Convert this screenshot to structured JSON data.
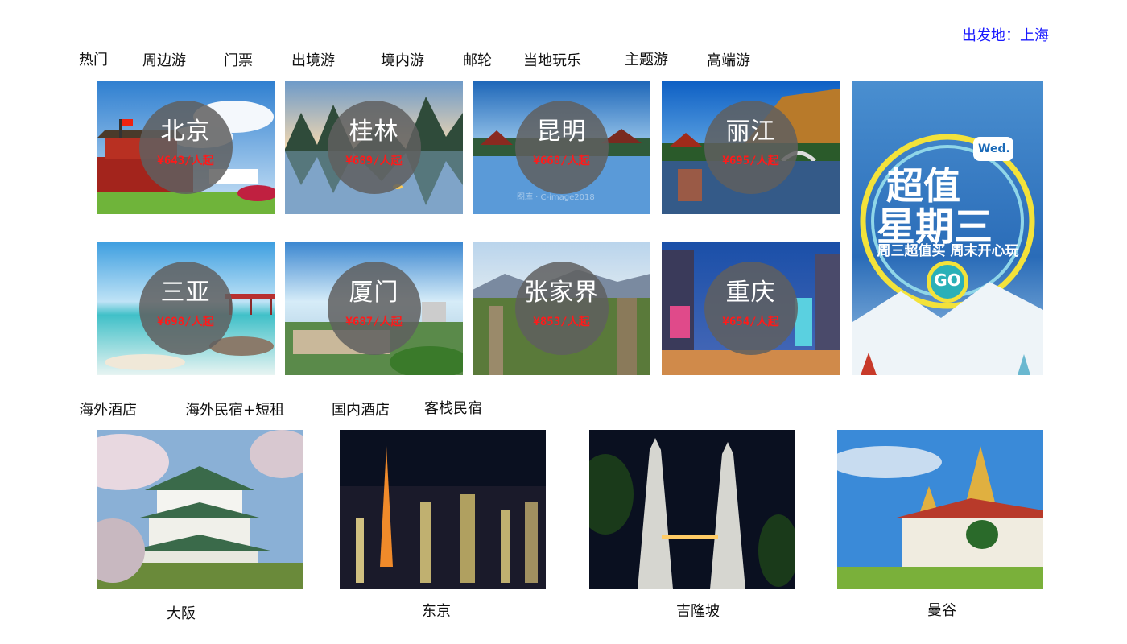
{
  "departure": {
    "label": "出发地：上海"
  },
  "nav_tabs": [
    "热门",
    "周边游",
    "门票",
    "出境游",
    "境内游",
    "邮轮",
    "当地玩乐",
    "主题游",
    "高端游"
  ],
  "destinations": [
    {
      "city": "北京",
      "price": "¥643/人起"
    },
    {
      "city": "桂林",
      "price": "¥689/人起"
    },
    {
      "city": "昆明",
      "price": "¥668/人起"
    },
    {
      "city": "丽江",
      "price": "¥695/人起"
    },
    {
      "city": "三亚",
      "price": "¥698/人起"
    },
    {
      "city": "厦门",
      "price": "¥687/人起"
    },
    {
      "city": "张家界",
      "price": "¥853/人起"
    },
    {
      "city": "重庆",
      "price": "¥654/人起"
    }
  ],
  "promo": {
    "title_line1": "超值",
    "title_line2": "星期三",
    "badge": "Wed.",
    "subtitle": "周三超值买 周末开心玩",
    "go": "GO"
  },
  "hotel_tabs": [
    "海外酒店",
    "海外民宿+短租",
    "国内酒店",
    "客栈民宿"
  ],
  "hotel_cities": [
    "大阪",
    "东京",
    "吉隆坡",
    "曼谷"
  ],
  "watermark": "图库 · C-image2018"
}
